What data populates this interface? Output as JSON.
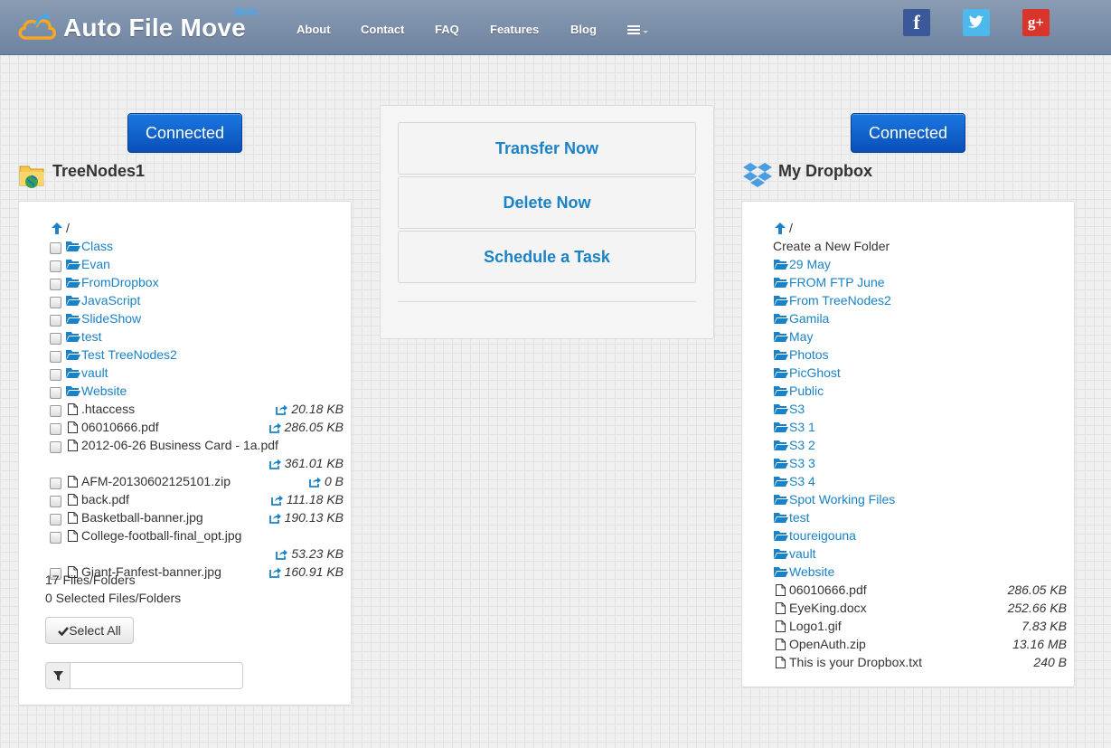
{
  "header": {
    "brand_title": "Auto File Move",
    "brand_badge": "Beta",
    "nav": [
      {
        "label": "About"
      },
      {
        "label": "Contact"
      },
      {
        "label": "FAQ"
      },
      {
        "label": "Features"
      },
      {
        "label": "Blog"
      }
    ],
    "social": {
      "facebook": "f",
      "twitter": "twitter-bird-icon",
      "googleplus": "g+"
    }
  },
  "left": {
    "status_button": "Connected",
    "title": "TreeNodes1",
    "up_label": "/",
    "items": [
      {
        "type": "folder",
        "name": "Class"
      },
      {
        "type": "folder",
        "name": "Evan"
      },
      {
        "type": "folder",
        "name": "FromDropbox"
      },
      {
        "type": "folder",
        "name": "JavaScript"
      },
      {
        "type": "folder",
        "name": "SlideShow"
      },
      {
        "type": "folder",
        "name": "test"
      },
      {
        "type": "folder",
        "name": "Test TreeNodes2"
      },
      {
        "type": "folder",
        "name": "vault"
      },
      {
        "type": "folder",
        "name": "Website"
      },
      {
        "type": "file",
        "name": ".htaccess",
        "size": "20.18 KB"
      },
      {
        "type": "file",
        "name": "06010666.pdf",
        "size": "286.05 KB"
      },
      {
        "type": "file",
        "name": "2012-06-26 Business Card - 1a.pdf",
        "size": "361.01 KB"
      },
      {
        "type": "file",
        "name": "AFM-20130602125101.zip",
        "size": "0 B"
      },
      {
        "type": "file",
        "name": "back.pdf",
        "size": "111.18 KB"
      },
      {
        "type": "file",
        "name": "Basketball-banner.jpg",
        "size": "190.13 KB"
      },
      {
        "type": "file",
        "name": "College-football-final_opt.jpg",
        "size": "53.23 KB"
      },
      {
        "type": "file",
        "name": "Giant-Fanfest-banner.jpg",
        "size": "160.91 KB"
      }
    ],
    "count_text": "17 Files/Folders",
    "selected_text": "0 Selected Files/Folders",
    "select_all_label": "Select All",
    "filter_value": ""
  },
  "center": {
    "transfer_label": "Transfer Now",
    "delete_label": "Delete Now",
    "schedule_label": "Schedule a Task"
  },
  "right": {
    "status_button": "Connected",
    "title": "My Dropbox",
    "up_label": "/",
    "create_folder_label": "Create a New Folder",
    "items": [
      {
        "type": "folder",
        "name": "29 May"
      },
      {
        "type": "folder",
        "name": "FROM FTP June"
      },
      {
        "type": "folder",
        "name": "From TreeNodes2"
      },
      {
        "type": "folder",
        "name": "Gamila"
      },
      {
        "type": "folder",
        "name": "May"
      },
      {
        "type": "folder",
        "name": "Photos"
      },
      {
        "type": "folder",
        "name": "PicGhost"
      },
      {
        "type": "folder",
        "name": "Public"
      },
      {
        "type": "folder",
        "name": "S3"
      },
      {
        "type": "folder",
        "name": "S3 1"
      },
      {
        "type": "folder",
        "name": "S3 2"
      },
      {
        "type": "folder",
        "name": "S3 3"
      },
      {
        "type": "folder",
        "name": "S3 4"
      },
      {
        "type": "folder",
        "name": "Spot Working Files"
      },
      {
        "type": "folder",
        "name": "test"
      },
      {
        "type": "folder",
        "name": "toureigouna"
      },
      {
        "type": "folder",
        "name": "vault"
      },
      {
        "type": "folder",
        "name": "Website"
      },
      {
        "type": "file",
        "name": "06010666.pdf",
        "size": "286.05 KB"
      },
      {
        "type": "file",
        "name": "EyeKing.docx",
        "size": "252.66 KB"
      },
      {
        "type": "file",
        "name": "Logo1.gif",
        "size": "7.83 KB"
      },
      {
        "type": "file",
        "name": "OpenAuth.zip",
        "size": "13.16 MB"
      },
      {
        "type": "file",
        "name": "This is your Dropbox.txt",
        "size": "240 B"
      }
    ]
  },
  "colors": {
    "link": "#1a82c6",
    "button_blue": "#0a4fb8",
    "header": "#7b8ea8"
  }
}
